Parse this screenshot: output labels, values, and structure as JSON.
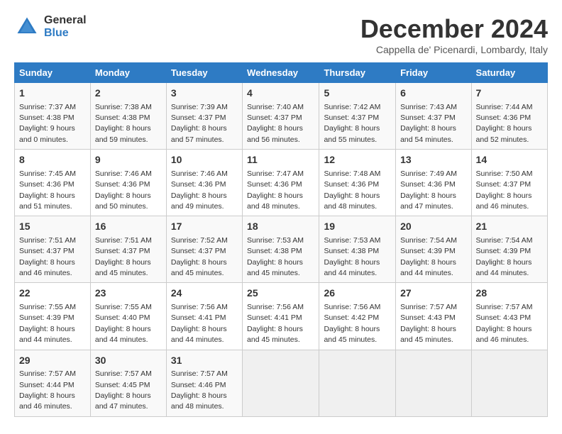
{
  "logo": {
    "general": "General",
    "blue": "Blue"
  },
  "title": "December 2024",
  "subtitle": "Cappella de' Picenardi, Lombardy, Italy",
  "header": {
    "days": [
      "Sunday",
      "Monday",
      "Tuesday",
      "Wednesday",
      "Thursday",
      "Friday",
      "Saturday"
    ]
  },
  "weeks": [
    [
      {
        "day": "1",
        "info": "Sunrise: 7:37 AM\nSunset: 4:38 PM\nDaylight: 9 hours and 0 minutes."
      },
      {
        "day": "2",
        "info": "Sunrise: 7:38 AM\nSunset: 4:38 PM\nDaylight: 8 hours and 59 minutes."
      },
      {
        "day": "3",
        "info": "Sunrise: 7:39 AM\nSunset: 4:37 PM\nDaylight: 8 hours and 57 minutes."
      },
      {
        "day": "4",
        "info": "Sunrise: 7:40 AM\nSunset: 4:37 PM\nDaylight: 8 hours and 56 minutes."
      },
      {
        "day": "5",
        "info": "Sunrise: 7:42 AM\nSunset: 4:37 PM\nDaylight: 8 hours and 55 minutes."
      },
      {
        "day": "6",
        "info": "Sunrise: 7:43 AM\nSunset: 4:37 PM\nDaylight: 8 hours and 54 minutes."
      },
      {
        "day": "7",
        "info": "Sunrise: 7:44 AM\nSunset: 4:36 PM\nDaylight: 8 hours and 52 minutes."
      }
    ],
    [
      {
        "day": "8",
        "info": "Sunrise: 7:45 AM\nSunset: 4:36 PM\nDaylight: 8 hours and 51 minutes."
      },
      {
        "day": "9",
        "info": "Sunrise: 7:46 AM\nSunset: 4:36 PM\nDaylight: 8 hours and 50 minutes."
      },
      {
        "day": "10",
        "info": "Sunrise: 7:46 AM\nSunset: 4:36 PM\nDaylight: 8 hours and 49 minutes."
      },
      {
        "day": "11",
        "info": "Sunrise: 7:47 AM\nSunset: 4:36 PM\nDaylight: 8 hours and 48 minutes."
      },
      {
        "day": "12",
        "info": "Sunrise: 7:48 AM\nSunset: 4:36 PM\nDaylight: 8 hours and 48 minutes."
      },
      {
        "day": "13",
        "info": "Sunrise: 7:49 AM\nSunset: 4:36 PM\nDaylight: 8 hours and 47 minutes."
      },
      {
        "day": "14",
        "info": "Sunrise: 7:50 AM\nSunset: 4:37 PM\nDaylight: 8 hours and 46 minutes."
      }
    ],
    [
      {
        "day": "15",
        "info": "Sunrise: 7:51 AM\nSunset: 4:37 PM\nDaylight: 8 hours and 46 minutes."
      },
      {
        "day": "16",
        "info": "Sunrise: 7:51 AM\nSunset: 4:37 PM\nDaylight: 8 hours and 45 minutes."
      },
      {
        "day": "17",
        "info": "Sunrise: 7:52 AM\nSunset: 4:37 PM\nDaylight: 8 hours and 45 minutes."
      },
      {
        "day": "18",
        "info": "Sunrise: 7:53 AM\nSunset: 4:38 PM\nDaylight: 8 hours and 45 minutes."
      },
      {
        "day": "19",
        "info": "Sunrise: 7:53 AM\nSunset: 4:38 PM\nDaylight: 8 hours and 44 minutes."
      },
      {
        "day": "20",
        "info": "Sunrise: 7:54 AM\nSunset: 4:39 PM\nDaylight: 8 hours and 44 minutes."
      },
      {
        "day": "21",
        "info": "Sunrise: 7:54 AM\nSunset: 4:39 PM\nDaylight: 8 hours and 44 minutes."
      }
    ],
    [
      {
        "day": "22",
        "info": "Sunrise: 7:55 AM\nSunset: 4:39 PM\nDaylight: 8 hours and 44 minutes."
      },
      {
        "day": "23",
        "info": "Sunrise: 7:55 AM\nSunset: 4:40 PM\nDaylight: 8 hours and 44 minutes."
      },
      {
        "day": "24",
        "info": "Sunrise: 7:56 AM\nSunset: 4:41 PM\nDaylight: 8 hours and 44 minutes."
      },
      {
        "day": "25",
        "info": "Sunrise: 7:56 AM\nSunset: 4:41 PM\nDaylight: 8 hours and 45 minutes."
      },
      {
        "day": "26",
        "info": "Sunrise: 7:56 AM\nSunset: 4:42 PM\nDaylight: 8 hours and 45 minutes."
      },
      {
        "day": "27",
        "info": "Sunrise: 7:57 AM\nSunset: 4:43 PM\nDaylight: 8 hours and 45 minutes."
      },
      {
        "day": "28",
        "info": "Sunrise: 7:57 AM\nSunset: 4:43 PM\nDaylight: 8 hours and 46 minutes."
      }
    ],
    [
      {
        "day": "29",
        "info": "Sunrise: 7:57 AM\nSunset: 4:44 PM\nDaylight: 8 hours and 46 minutes."
      },
      {
        "day": "30",
        "info": "Sunrise: 7:57 AM\nSunset: 4:45 PM\nDaylight: 8 hours and 47 minutes."
      },
      {
        "day": "31",
        "info": "Sunrise: 7:57 AM\nSunset: 4:46 PM\nDaylight: 8 hours and 48 minutes."
      },
      null,
      null,
      null,
      null
    ]
  ]
}
